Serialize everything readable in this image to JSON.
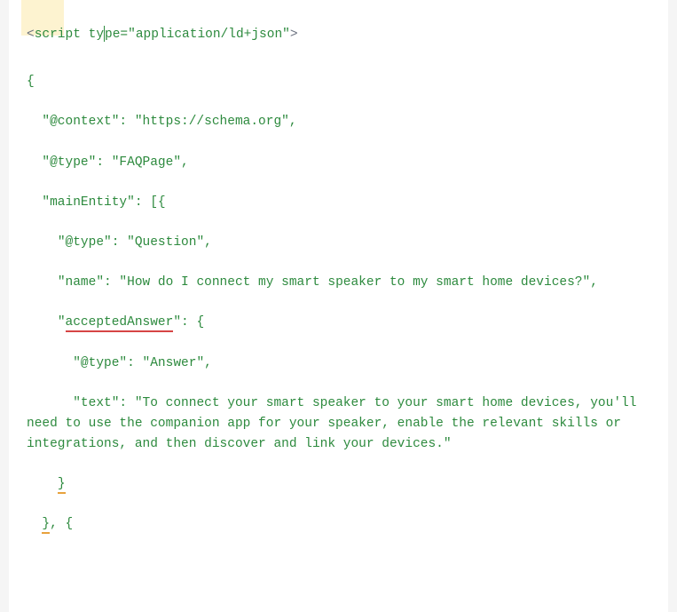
{
  "code": {
    "scriptTag": {
      "openLt": "<",
      "tagName": "script",
      "attr": " ty",
      "attrRest": "pe=\"application/ld+json\"",
      "closeGt": ">"
    },
    "lines": {
      "l1": "{",
      "l2": "  \"@context\": \"https://schema.org\",",
      "l3": "  \"@type\": \"FAQPage\",",
      "l4": "  \"mainEntity\": [{",
      "l5": "    \"@type\": \"Question\",",
      "l6": "    \"name\": \"How do I connect my smart speaker to my smart home devices?\",",
      "l7a": "    \"",
      "l7b": "acceptedAnswer",
      "l7c": "\": {",
      "l8": "      \"@type\": \"Answer\",",
      "l9": "      \"text\": \"To connect your smart speaker to your smart home devices, you'll need to use the companion app for your speaker, enable the relevant skills or integrations, and then discover and link your devices.\"",
      "l10a": "    ",
      "l10b": "}",
      "l11a": "  ",
      "l11b": "}",
      "l11c": ", {"
    }
  }
}
